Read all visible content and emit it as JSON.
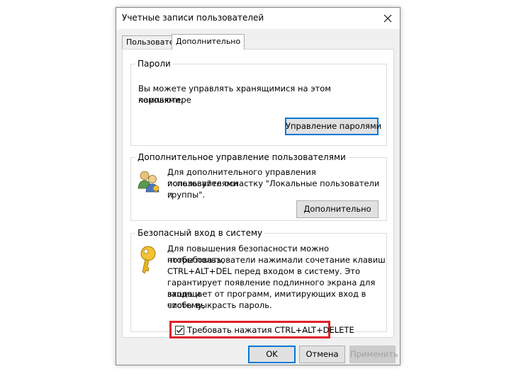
{
  "dialog": {
    "title": "Учетные записи пользователей",
    "close_glyph": "✕"
  },
  "tabs": [
    {
      "label": "Пользователи",
      "active": false
    },
    {
      "label": "Дополнительно",
      "active": true
    }
  ],
  "passwords": {
    "group_label": "Пароли",
    "text_line1": "Вы можете управлять хранящимися на этом компьютере",
    "text_line2": "паролями.",
    "button": "Управление паролями"
  },
  "advanced_users": {
    "group_label": "Дополнительное управление пользователями",
    "text_line1": "Для дополнительного управления пользователями",
    "text_line2": "используйте оснастку \"Локальные пользователи и",
    "text_line3": "группы\".",
    "button": "Дополнительно",
    "icon": "users-icon"
  },
  "secure_logon": {
    "group_label": "Безопасный вход в систему",
    "text_line1": "Для повышения безопасности можно потребовать,",
    "text_line2": "чтобы пользователи нажимали сочетание клавиш",
    "text_line3": "CTRL+ALT+DEL перед входом в систему. Это",
    "text_line4": "гарантирует появление подлинного экрана для входа и",
    "text_line5": "защищает от программ, имитирующих вход в систему,",
    "text_line6": "чтобы выкрасть пароль.",
    "icon": "key-icon",
    "checkbox_label": "Требовать нажатия CTRL+ALT+DELETE",
    "checkbox_checked": true,
    "highlight_color": "#e0202a"
  },
  "footer": {
    "ok": "OK",
    "cancel": "Отмена",
    "apply": "Применить"
  },
  "colors": {
    "accent": "#0078d7",
    "dialog_bg": "#f0f0f0",
    "panel_bg": "#ffffff"
  }
}
